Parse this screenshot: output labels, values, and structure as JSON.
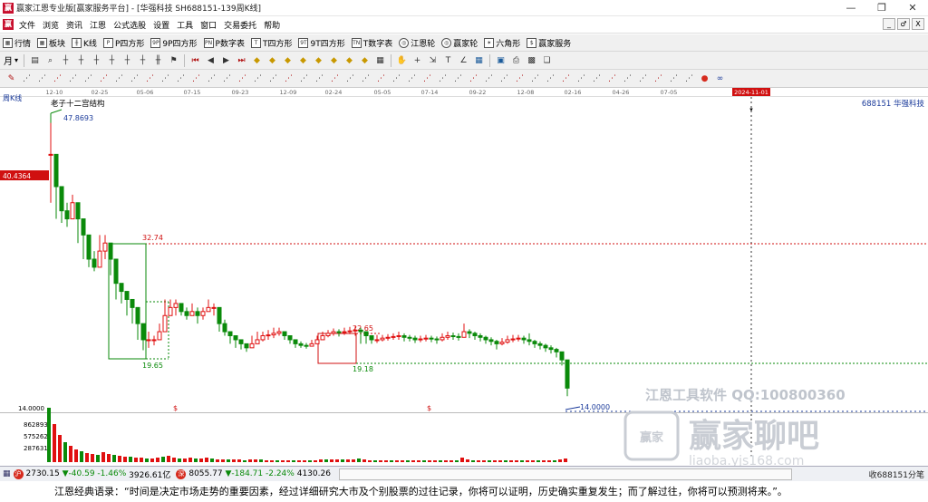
{
  "window": {
    "title": "赢家江恩专业版[赢家服务平台] - [华强科技  SH688151-139周K线]",
    "app_icon": "赢",
    "buttons": [
      "—",
      "❐",
      "✕"
    ]
  },
  "menu": {
    "logo": "赢",
    "items": [
      "文件",
      "浏览",
      "资讯",
      "江恩",
      "公式选股",
      "设置",
      "工具",
      "窗口",
      "交易委托",
      "帮助"
    ],
    "mdi": [
      "_",
      "♂",
      "X"
    ]
  },
  "toolbar1": {
    "items": [
      {
        "icon": "grid-icon",
        "glyph": "▦",
        "label": "行情"
      },
      {
        "icon": "blocks-icon",
        "glyph": "▦",
        "label": "板块"
      },
      {
        "icon": "candlestick-icon",
        "glyph": "╫",
        "label": "K线"
      },
      {
        "icon": "p-square-icon",
        "glyph": "P",
        "label": "P四方形"
      },
      {
        "icon": "9p-square-icon",
        "glyph": "9P",
        "label": "9P四方形"
      },
      {
        "icon": "pn-square-icon",
        "glyph": "PN",
        "label": "P数字表"
      },
      {
        "icon": "t-square-icon",
        "glyph": "T",
        "label": "T四方形"
      },
      {
        "icon": "9t-square-icon",
        "glyph": "9T",
        "label": "9T四方形"
      },
      {
        "icon": "tn-square-icon",
        "glyph": "TN",
        "label": "T数字表"
      },
      {
        "icon": "gann-wheel-icon",
        "glyph": "◎",
        "label": "江恩轮"
      },
      {
        "icon": "winner-wheel-icon",
        "glyph": "◎",
        "label": "赢家轮"
      },
      {
        "icon": "hexagon-icon",
        "glyph": "✶",
        "label": "六角形"
      },
      {
        "icon": "dollar-icon",
        "glyph": "$",
        "label": "赢家服务"
      }
    ]
  },
  "toolbar2": {
    "period_label": "月",
    "icons": [
      "calendar-icon",
      "zoom-icon",
      "bars-icon",
      "bars-icon",
      "bars-icon",
      "bars-icon",
      "bars-icon",
      "bars-icon",
      "candle-icon",
      "flag-icon",
      "first-icon",
      "prev-icon",
      "next-icon",
      "last-icon",
      "diamond-icon",
      "diamond-icon",
      "diamond-icon",
      "diamond-icon",
      "diamond-icon",
      "diamond-icon",
      "diamond-icon",
      "diamond-icon",
      "grid-icon",
      "hand-icon",
      "cross-icon",
      "measure-icon",
      "text-icon",
      "angle-icon",
      "table-icon",
      "save-icon",
      "print-icon",
      "image-icon",
      "layers-icon"
    ]
  },
  "toolbar3": {
    "icons": [
      "pen-icon",
      "fan-icon",
      "fan-icon",
      "fan-icon",
      "fan-icon",
      "fan-icon",
      "fan-icon",
      "fan-icon",
      "fan-icon",
      "fan-icon",
      "fan-icon",
      "fan-icon",
      "fan-icon",
      "fan-icon",
      "fan-icon",
      "fan-icon",
      "fan-icon",
      "fan-icon",
      "fan-icon",
      "fan-icon",
      "fan-icon",
      "fan-icon",
      "fan-icon",
      "fan-icon",
      "fan-icon",
      "fan-icon",
      "fan-icon",
      "fan-icon",
      "fan-icon",
      "fan-icon",
      "fan-icon",
      "fan-icon",
      "fan-icon",
      "fan-icon",
      "fan-icon",
      "fan-icon",
      "fan-icon",
      "fan-icon",
      "fan-icon",
      "fan-icon",
      "fan-icon",
      "fan-icon",
      "fan-icon",
      "fan-icon",
      "fan-icon",
      "color-icon",
      "infinity-icon"
    ]
  },
  "chart": {
    "period_label": "周K线",
    "stock_label": "688151  华强科技",
    "structure_label": "老子十二宫结构",
    "date_ticks": [
      "12-10",
      "02-25",
      "05-06",
      "07-15",
      "09-23",
      "12-09",
      "02-24",
      "05-05",
      "07-14",
      "09-22",
      "12-08",
      "02-16",
      "04-26",
      "07-05"
    ],
    "marker_date": "2024-11-01",
    "current_price_label": "40.4364",
    "annotations": {
      "high": "47.8693",
      "p1": "32.74",
      "low1": "19.65",
      "p2": "22.65",
      "low2": "19.18",
      "last": "14.0000"
    },
    "volume_axis": {
      "top": "14.0000",
      "ticks": [
        "862893",
        "575262",
        "287631"
      ]
    },
    "dollar_marks": [
      "$",
      "$"
    ],
    "watermark": {
      "line1": "江恩工具软件  QQ:100800360",
      "logo_text": "赢家聊吧",
      "seal": "赢家",
      "url": "liaoba.yjs168.com"
    },
    "colors": {
      "up": "#e01010",
      "down": "#0a8a0a",
      "accent": "#d62b1e"
    }
  },
  "chart_data": {
    "type": "candlestick",
    "x": [
      "12-10",
      "02-25",
      "05-06",
      "07-15",
      "09-23",
      "12-09",
      "02-24",
      "05-05",
      "07-14",
      "09-22",
      "12-08",
      "02-16",
      "04-26",
      "07-05"
    ],
    "close_approx": [
      47.87,
      34.0,
      31.5,
      25.0,
      23.0,
      20.5,
      20.0,
      21.0,
      21.5,
      20.5,
      20.8,
      20.0,
      14.0
    ],
    "key_levels": [
      47.8693,
      40.4364,
      32.74,
      22.65,
      19.65,
      19.18,
      14.0
    ],
    "ylim": [
      12,
      50
    ],
    "grid": false,
    "legend": "none"
  },
  "status": {
    "sh": {
      "badge": "沪",
      "text1": "2730.15",
      "text2": "▼-40.59",
      "text3": "-1.46%",
      "text4": "3926.61亿"
    },
    "sz": {
      "badge": "深",
      "text1": "8055.77",
      "text2": "▼-184.71",
      "text3": "-2.24%",
      "text4": "4130.26"
    },
    "right": "收688151分笔"
  },
  "footer": {
    "quote": "江恩经典语录：“时间是决定市场走势的重要因素，经过详细研究大市及个别股票的过往记录，你将可以证明，历史确实重复发生；而了解过往，你将可以预测将来。”。"
  }
}
